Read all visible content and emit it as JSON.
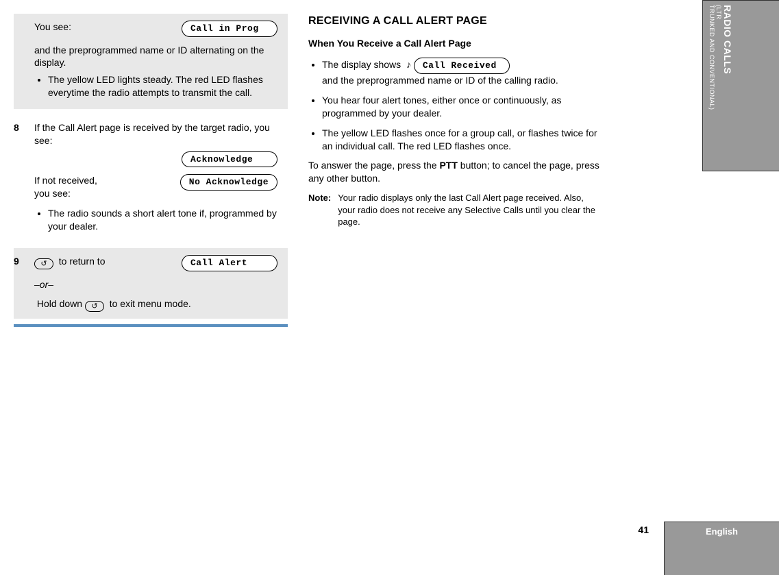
{
  "left": {
    "step7": {
      "you_see": "You see:",
      "lcd1": "Call in Prog",
      "desc1": "and the preprogrammed name or ID alternating on the display.",
      "bullet1": "The yellow LED lights steady. The red LED flashes everytime the radio attempts to transmit the call."
    },
    "step8": {
      "num": "8",
      "line1": "If the Call Alert page is received by the target radio, you see:",
      "lcd_ack": "Acknowledge",
      "line2a": "If not received,",
      "line2b": "you see:",
      "lcd_noack": "No Acknowledge",
      "bullet1": "The radio sounds a short alert tone if, programmed by your dealer."
    },
    "step9": {
      "num": "9",
      "btn_glyph": "↺",
      "to_return": "to return to",
      "lcd_alert": "Call Alert",
      "or": "–or–",
      "hold_pre": "Hold down",
      "hold_post": "to exit menu mode."
    }
  },
  "right": {
    "heading": "RECEIVING A CALL ALERT PAGE",
    "subheading": "When You Receive a Call Alert Page",
    "bullet1_pre": "The display shows",
    "lcd_received": "Call Received",
    "bullet1_post": "and the preprogrammed name or ID of the calling radio.",
    "bullet2": "You hear four alert tones, either once or continuously, as programmed by your dealer.",
    "bullet3": "The yellow LED flashes once for a group call, or flashes twice for an individual call. The red LED flashes once.",
    "answer_pre": "To answer the page, press the ",
    "ptt": "PTT",
    "answer_post": " button; to cancel the page, press any other button.",
    "note_label": "Note:",
    "note_text": "Your radio displays only the last Call Alert page received. Also, your radio does not receive any Selective Calls until you clear the page."
  },
  "sidebar": {
    "main": "RADIO CALLS",
    "sub1": "(LTR",
    "sub2": "TRUNKED AND CONVENTIONAL)"
  },
  "footer": {
    "lang": "English",
    "page": "41"
  },
  "icons": {
    "note": "♪"
  }
}
